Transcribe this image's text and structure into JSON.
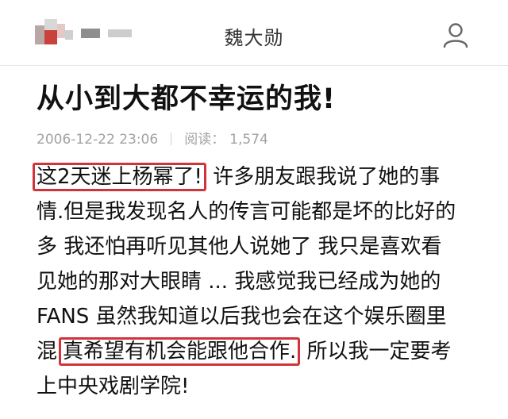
{
  "header": {
    "title": "魏大勋",
    "user_icon": "user-icon",
    "logo": "blurred-logo"
  },
  "article": {
    "title": "从小到大都不幸运的我!",
    "meta": {
      "datetime": "2006-12-22 23:06",
      "reads_label": "阅读：",
      "reads_count": "1,574"
    },
    "lines": [
      {
        "highlight": "这2天迷上杨幂了!",
        "rest": "许多朋友跟我说了她的事"
      },
      {
        "text": "情.但是我发现名人的传言可能都是坏的比好的"
      },
      {
        "text": "多 我还怕再听见其他人说她了 我只是喜欢看"
      },
      {
        "text": "见她的那对大眼睛 ... 我感觉我已经成为她的"
      },
      {
        "text": "FANS 虽然我知道以后我也会在这个娱乐圈里"
      },
      {
        "pre": "混",
        "highlight": "真希望有机会能跟他合作.",
        "rest": "所以我一定要考"
      },
      {
        "text": "上中央戏剧学院!"
      }
    ]
  },
  "colors": {
    "highlight_border": "#d0343a",
    "meta_text": "#a2a2a2"
  }
}
